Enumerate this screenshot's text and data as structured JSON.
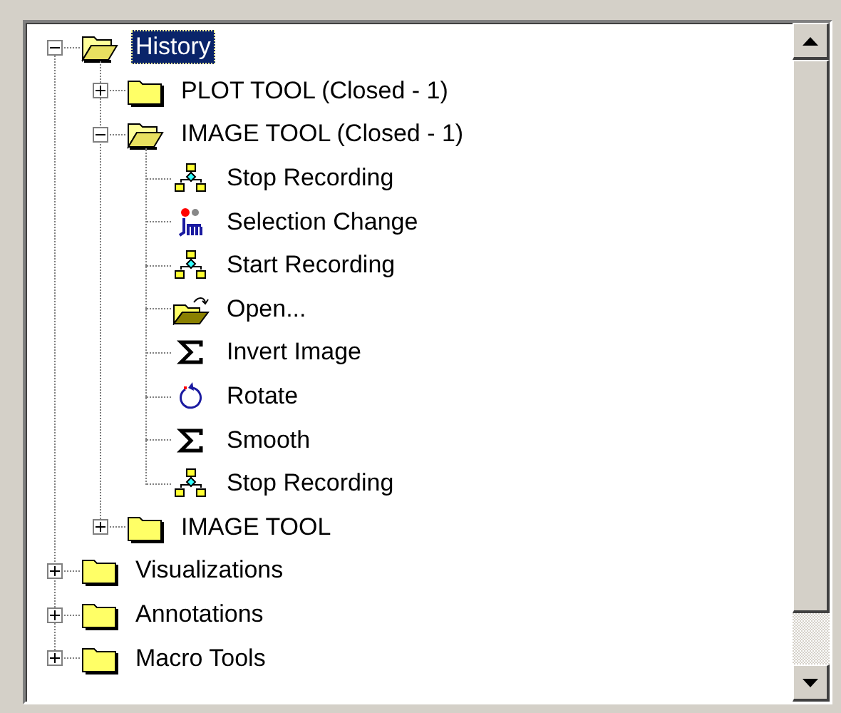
{
  "tree": [
    {
      "label": "History",
      "kind": "folder",
      "expanded": true,
      "selected": true,
      "children": [
        {
          "label": "PLOT TOOL (Closed - 1)",
          "kind": "folder",
          "expanded": false,
          "selected": false
        },
        {
          "label": "IMAGE TOOL (Closed - 1)",
          "kind": "folder",
          "expanded": true,
          "selected": false,
          "children": [
            {
              "label": "Stop Recording",
              "kind": "record",
              "selected": false
            },
            {
              "label": "Selection Change",
              "kind": "selection",
              "selected": false
            },
            {
              "label": "Start Recording",
              "kind": "record",
              "selected": false
            },
            {
              "label": "Open...",
              "kind": "open",
              "selected": false
            },
            {
              "label": "Invert Image",
              "kind": "sigma",
              "selected": false
            },
            {
              "label": "Rotate",
              "kind": "rotate",
              "selected": false
            },
            {
              "label": "Smooth",
              "kind": "sigma",
              "selected": false
            },
            {
              "label": "Stop Recording",
              "kind": "record",
              "selected": false
            }
          ]
        },
        {
          "label": "IMAGE TOOL",
          "kind": "folder",
          "expanded": false,
          "selected": false
        }
      ]
    },
    {
      "label": "Visualizations",
      "kind": "folder",
      "expanded": false,
      "selected": false
    },
    {
      "label": "Annotations",
      "kind": "folder",
      "expanded": false,
      "selected": false
    },
    {
      "label": "Macro Tools",
      "kind": "folder",
      "expanded": false,
      "selected": false
    }
  ]
}
